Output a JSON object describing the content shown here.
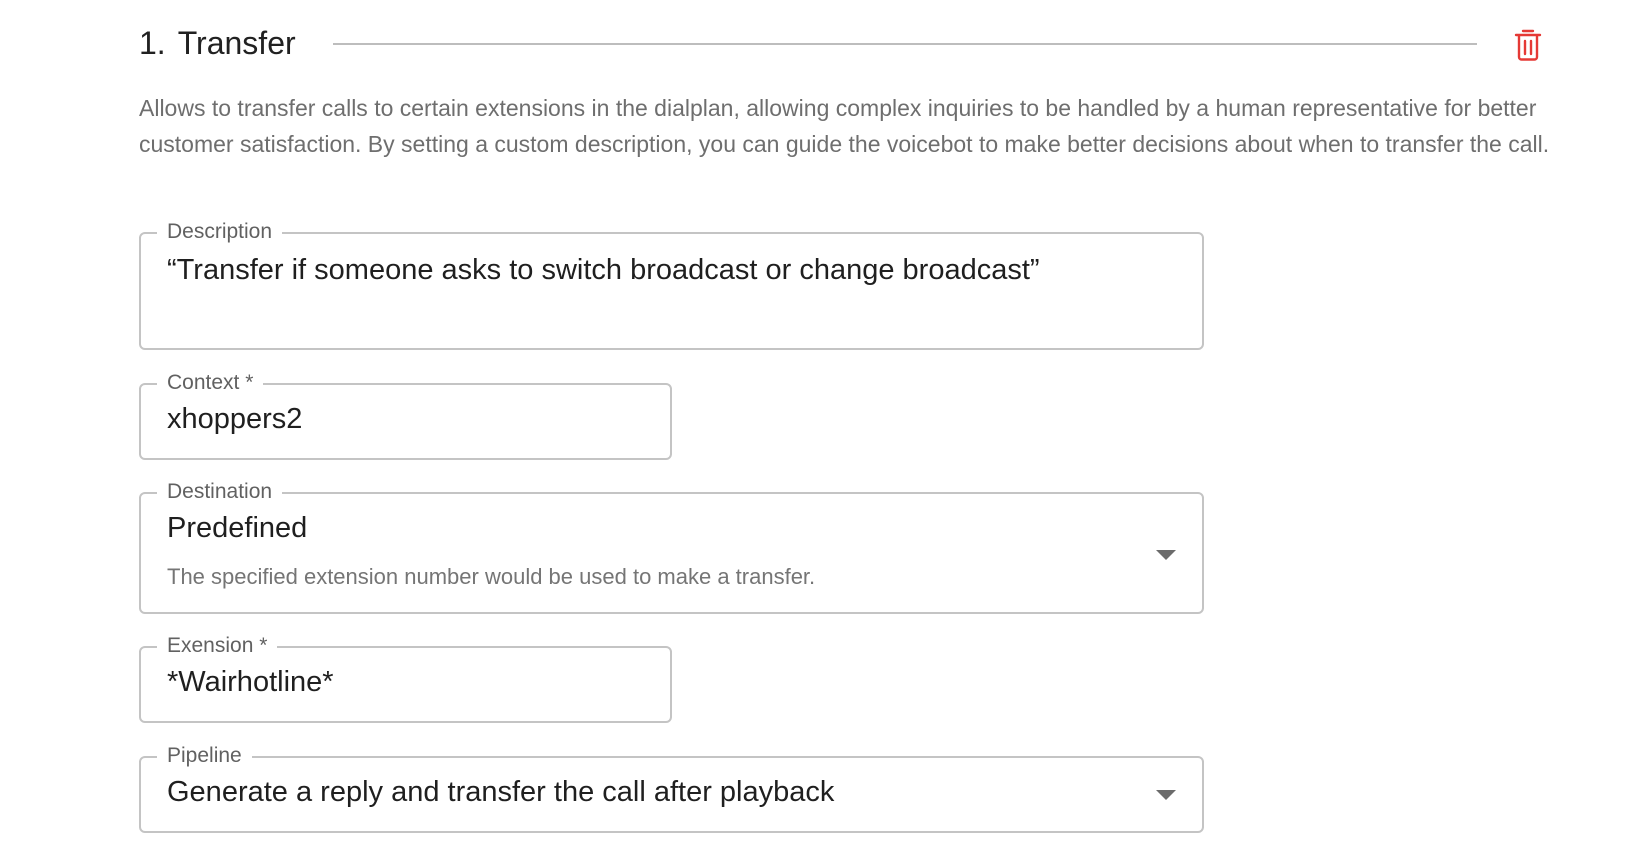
{
  "section": {
    "number": "1.",
    "title": "Transfer",
    "description": "Allows to transfer calls to certain extensions in the dialplan, allowing complex inquiries to be handled by a human representative for better customer satisfaction. By setting a custom description, you can guide the voicebot to make better decisions about when to transfer the call."
  },
  "icons": {
    "delete": "trash-icon",
    "dropdown": "caret-down-icon"
  },
  "colors": {
    "delete_icon": "#e53935"
  },
  "fields": {
    "description": {
      "label": "Description",
      "value": "“Transfer if someone asks to switch broadcast or change broadcast”"
    },
    "context": {
      "label": "Context *",
      "value": "xhoppers2"
    },
    "destination": {
      "label": "Destination",
      "value": "Predefined",
      "helper": "The specified extension number would be used to make a transfer."
    },
    "extension": {
      "label": "Exension *",
      "value": "*Wairhotline*"
    },
    "pipeline": {
      "label": "Pipeline",
      "value": "Generate a reply and transfer the call after playback"
    }
  }
}
